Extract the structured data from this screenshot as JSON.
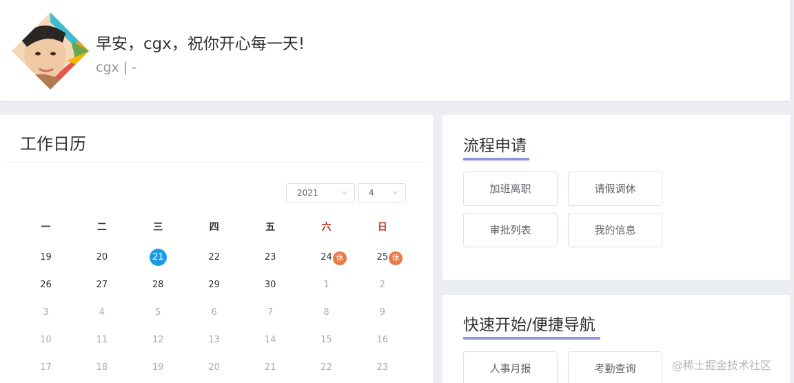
{
  "header": {
    "greeting": "早安，cgx，祝你开心每一天!",
    "subtitle": "cgx | -"
  },
  "calendar": {
    "title": "工作日历",
    "year": "2021",
    "month": "4",
    "weekdays": [
      "一",
      "二",
      "三",
      "四",
      "五",
      "六",
      "日"
    ],
    "weekend_color": "#c0341e",
    "today_color": "#1d9be3",
    "rest_badge_color": "#ea7a45",
    "rest_label": "休",
    "weeks": [
      [
        {
          "d": "19"
        },
        {
          "d": "20"
        },
        {
          "d": "21",
          "today": true
        },
        {
          "d": "22"
        },
        {
          "d": "23"
        },
        {
          "d": "24",
          "rest": true
        },
        {
          "d": "25",
          "rest": true
        }
      ],
      [
        {
          "d": "26"
        },
        {
          "d": "27"
        },
        {
          "d": "28"
        },
        {
          "d": "29"
        },
        {
          "d": "30"
        },
        {
          "d": "1",
          "other": true
        },
        {
          "d": "2",
          "other": true
        }
      ],
      [
        {
          "d": "3",
          "other": true
        },
        {
          "d": "4",
          "other": true
        },
        {
          "d": "5",
          "other": true
        },
        {
          "d": "6",
          "other": true
        },
        {
          "d": "7",
          "other": true
        },
        {
          "d": "8",
          "other": true
        },
        {
          "d": "9",
          "other": true
        }
      ],
      [
        {
          "d": "10",
          "other": true
        },
        {
          "d": "11",
          "other": true
        },
        {
          "d": "12",
          "other": true
        },
        {
          "d": "13",
          "other": true
        },
        {
          "d": "14",
          "other": true
        },
        {
          "d": "15",
          "other": true
        },
        {
          "d": "16",
          "other": true
        }
      ],
      [
        {
          "d": "17",
          "other": true
        },
        {
          "d": "18",
          "other": true
        },
        {
          "d": "19",
          "other": true
        },
        {
          "d": "20",
          "other": true
        },
        {
          "d": "21",
          "other": true
        },
        {
          "d": "22",
          "other": true
        },
        {
          "d": "23",
          "other": true
        }
      ]
    ]
  },
  "process": {
    "title": "流程申请",
    "buttons": [
      "加班离职",
      "请假调休",
      "审批列表",
      "我的信息"
    ]
  },
  "quick": {
    "title": "快速开始/便捷导航",
    "buttons": [
      "人事月报",
      "考勤查询"
    ]
  },
  "accent_color": "#8c97dc",
  "watermark": "@稀土掘金技术社区"
}
